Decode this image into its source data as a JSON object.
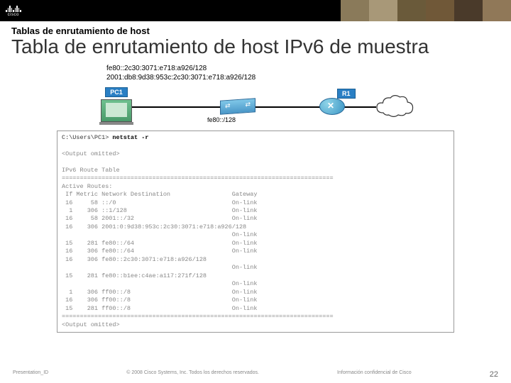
{
  "header": {
    "brand": "cisco"
  },
  "breadcrumb": "Tablas de enrutamiento de host",
  "title": "Tabla de enrutamiento de host IPv6 de muestra",
  "diagram": {
    "pc_ipv6_ll": "fe80::2c30:3071:e718:a926/128",
    "pc_ipv6_gua": "2001:db8:9d38:953c:2c30:3071:e718:a926/128",
    "switch_net": "fe80::/128",
    "pc_label": "PC1",
    "router_label": "R1"
  },
  "terminal": {
    "prompt": "C:\\Users\\PC1>",
    "command": "netstat -r",
    "omit1": "<Output omitted>",
    "heading": "IPv6 Route Table",
    "sep": "===========================================================================",
    "active": "Active Routes:",
    "cols": " If Metric Network Destination                 Gateway",
    "rows": [
      " 16     58 ::/0                                On-link",
      "  1    306 ::1/128                             On-link",
      " 16     58 2001::/32                           On-link",
      " 16    306 2001:0:9d38:953c:2c30:3071:e718:a926/128",
      "                                               On-link",
      " 15    281 fe80::/64                           On-link",
      " 16    306 fe80::/64                           On-link",
      " 16    306 fe80::2c30:3071:e718:a926/128",
      "                                               On-link",
      " 15    281 fe80::b1ee:c4ae:a117:271f/128",
      "                                               On-link",
      "  1    306 ff00::/8                            On-link",
      " 16    306 ff00::/8                            On-link",
      " 15    281 ff00::/8                            On-link"
    ],
    "omit2": "<Output omitted>"
  },
  "footer": {
    "left": "Presentation_ID",
    "center": "© 2008 Cisco Systems, Inc. Todos los derechos reservados.",
    "right": "Información confidencial de Cisco",
    "page": "22"
  }
}
